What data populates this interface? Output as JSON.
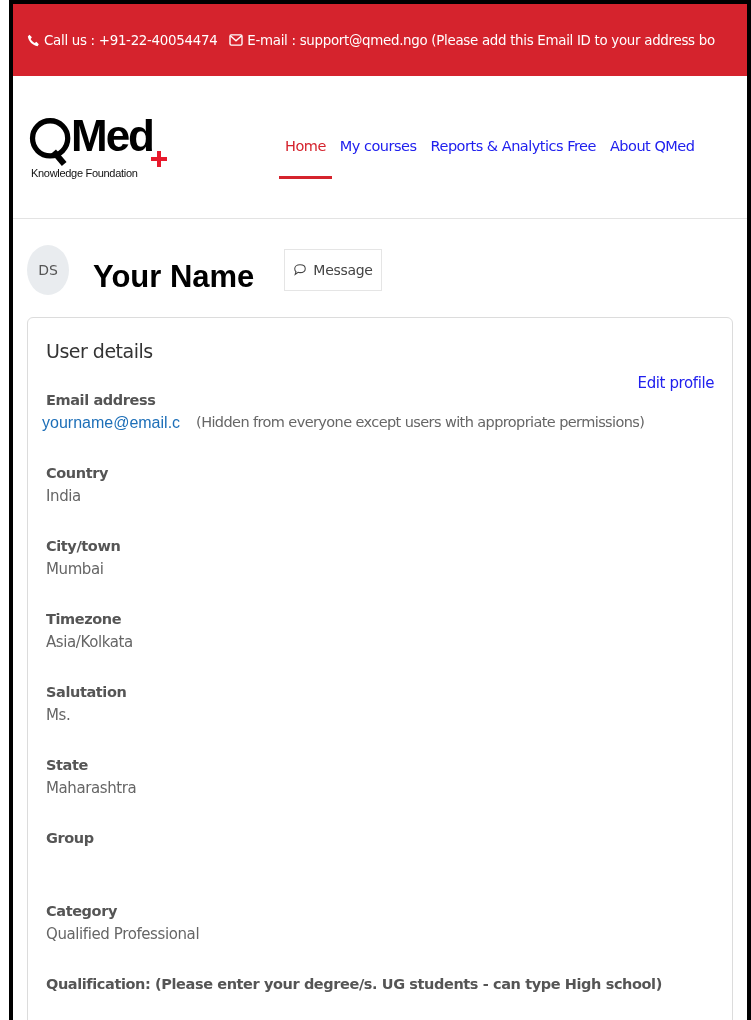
{
  "top_bar": {
    "phone": "Call us : +91-22-40054474",
    "email": "E-mail : support@qmed.ngo (Please add this Email ID to your address bo"
  },
  "logo": {
    "wordmark": "Med",
    "tagline": "Knowledge Foundation"
  },
  "nav": [
    {
      "label": "Home",
      "selected": true
    },
    {
      "label": "My courses",
      "selected": false
    },
    {
      "label": "Reports & Analytics Free",
      "selected": false
    },
    {
      "label": "About QMed",
      "selected": false
    }
  ],
  "profile": {
    "initials": "DS",
    "name": "Your Name",
    "message_button": "Message"
  },
  "card": {
    "title": "User details",
    "edit_link": "Edit profile",
    "fields": [
      {
        "label": "Email address",
        "value": "yourname@email.c",
        "note": "(Hidden from everyone except users with appropriate permissions)"
      },
      {
        "label": "Country",
        "value": "India"
      },
      {
        "label": "City/town",
        "value": "Mumbai"
      },
      {
        "label": "Timezone",
        "value": "Asia/Kolkata"
      },
      {
        "label": "Salutation",
        "value": "Ms."
      },
      {
        "label": "State",
        "value": "Maharashtra"
      },
      {
        "label": "Group"
      },
      {
        "label": "Category",
        "value": "Qualified Professional"
      },
      {
        "label": "Qualification: (Please enter your degree/s. UG students - can type High school)"
      }
    ]
  }
}
